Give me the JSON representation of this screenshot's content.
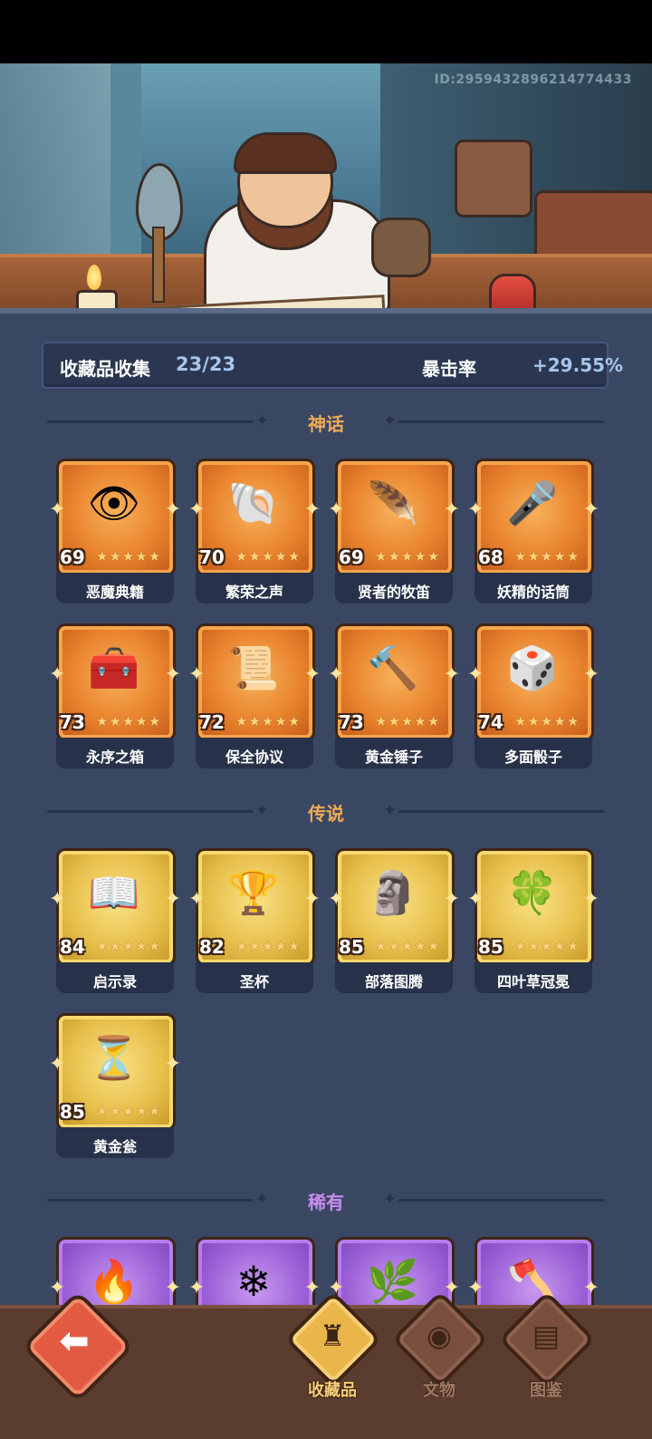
{
  "player_id": "ID:2959432896214774433",
  "summary": {
    "label": "收藏品收集",
    "count": "23/23",
    "crit_label": "暴击率",
    "crit_value": "+29.55%"
  },
  "sections": {
    "mythic": {
      "title": "神话",
      "color": "#f0a955"
    },
    "legend": {
      "title": "传说",
      "color": "#f0a955"
    },
    "rare": {
      "title": "稀有",
      "color": "#c98df0"
    }
  },
  "mythic_items": [
    {
      "name": "恶魔典籍",
      "level": "69",
      "icon": "demon-tome-icon",
      "glyph": "👁"
    },
    {
      "name": "繁荣之声",
      "level": "70",
      "icon": "prosperity-voice-icon",
      "glyph": "🐚"
    },
    {
      "name": "贤者的牧笛",
      "level": "69",
      "icon": "sage-flute-icon",
      "glyph": "🪶"
    },
    {
      "name": "妖精的话筒",
      "level": "68",
      "icon": "fairy-microphone-icon",
      "glyph": "🎤"
    },
    {
      "name": "永序之箱",
      "level": "73",
      "icon": "eternal-chest-icon",
      "glyph": "🧰"
    },
    {
      "name": "保全协议",
      "level": "72",
      "icon": "preservation-contract-icon",
      "glyph": "📜"
    },
    {
      "name": "黄金锤子",
      "level": "73",
      "icon": "golden-hammer-icon",
      "glyph": "🔨"
    },
    {
      "name": "多面骰子",
      "level": "74",
      "icon": "polyhedral-dice-icon",
      "glyph": "🎲"
    }
  ],
  "legend_items": [
    {
      "name": "启示录",
      "level": "84",
      "icon": "revelation-book-icon",
      "glyph": "📖"
    },
    {
      "name": "圣杯",
      "level": "82",
      "icon": "holy-grail-icon",
      "glyph": "🏆"
    },
    {
      "name": "部落图腾",
      "level": "85",
      "icon": "tribal-totem-icon",
      "glyph": "🗿"
    },
    {
      "name": "四叶草冠冕",
      "level": "85",
      "icon": "clover-crown-icon",
      "glyph": "🍀"
    },
    {
      "name": "黄金瓮",
      "level": "85",
      "icon": "golden-urn-icon",
      "glyph": "⏳"
    }
  ],
  "rare_items": [
    {
      "icon": "phoenix-feather-icon",
      "glyph": "🔥"
    },
    {
      "icon": "frost-spirit-icon",
      "glyph": "❄"
    },
    {
      "icon": "vine-wreath-icon",
      "glyph": "🌿"
    },
    {
      "icon": "stone-axe-icon",
      "glyph": "🪓"
    }
  ],
  "nav": {
    "back_glyph": "⬅",
    "tabs": [
      {
        "label": "收藏品",
        "icon": "collection-chest-icon",
        "glyph": "♜",
        "active": true
      },
      {
        "label": "文物",
        "icon": "artifact-eye-icon",
        "glyph": "◉",
        "active": false
      },
      {
        "label": "图鉴",
        "icon": "codex-book-icon",
        "glyph": "▤",
        "active": false
      }
    ]
  },
  "colors": {
    "background": "#3a4763",
    "mythic": "#e9822c",
    "legend": "#e8c04c",
    "rare": "#9d62d7",
    "accent_blue": "#a6c6ec"
  }
}
